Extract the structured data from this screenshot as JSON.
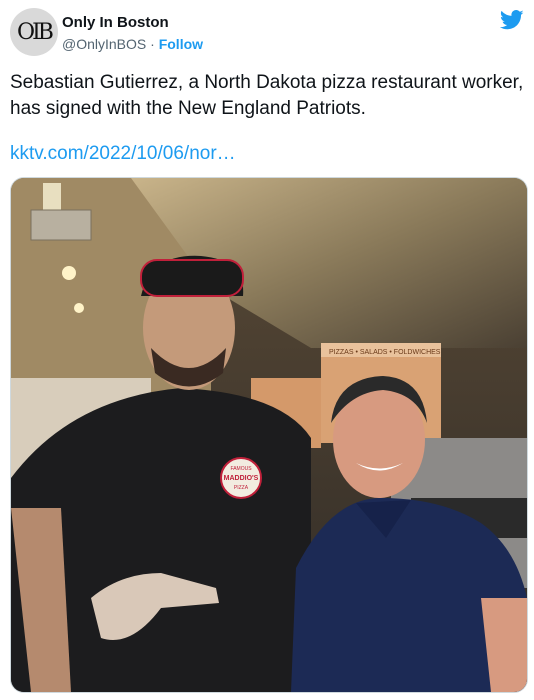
{
  "account": {
    "display_name": "Only In Boston",
    "handle": "@OnlyInBOS",
    "separator": "·",
    "follow_label": "Follow",
    "avatar_monogram": "OIB"
  },
  "tweet": {
    "text": "Sebastian Gutierrez, a North Dakota pizza restaurant worker, has signed with the New England Patriots.",
    "link_text": "kktv.com/2022/10/06/nor…"
  },
  "photo": {
    "shirt_logo_top": "FAMOUS",
    "shirt_logo_main": "MADDIO'S",
    "shirt_logo_bottom": "PIZZA",
    "box_label": "PIZZAS • SALADS • FOLDWICHES"
  },
  "icons": {
    "brand": "twitter-bird-icon",
    "brand_color": "#1d9bf0"
  }
}
